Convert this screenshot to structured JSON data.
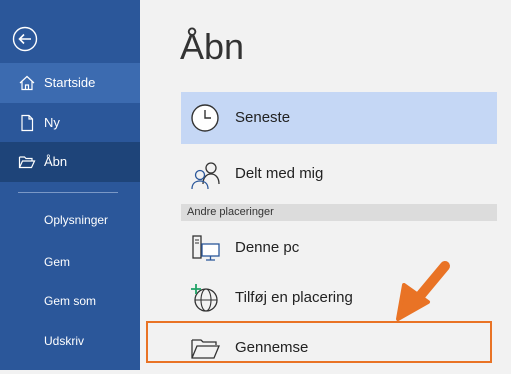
{
  "sidebar": {
    "back_icon": "back-arrow-circle-icon",
    "items": [
      {
        "label": "Startside",
        "icon": "home-icon"
      },
      {
        "label": "Ny",
        "icon": "new-document-icon"
      },
      {
        "label": "Åbn",
        "icon": "open-folder-icon"
      }
    ],
    "text_items": [
      "Oplysninger",
      "Gem",
      "Gem som",
      "Udskriv"
    ]
  },
  "main": {
    "title": "Åbn",
    "locations": [
      {
        "label": "Seneste",
        "icon": "clock-icon",
        "selected": true
      },
      {
        "label": "Delt med mig",
        "icon": "people-icon"
      }
    ],
    "section_header": "Andre placeringer",
    "other_locations": [
      {
        "label": "Denne pc",
        "icon": "computer-icon"
      },
      {
        "label": "Tilføj en placering",
        "icon": "globe-add-icon"
      },
      {
        "label": "Gennemse",
        "icon": "folder-icon"
      }
    ]
  },
  "colors": {
    "sidebar_bg": "#2b579a",
    "sidebar_active": "#1e4479",
    "sidebar_hover": "#3c6bb0",
    "selected_bg": "#c5d7f5",
    "highlight": "#e97325"
  }
}
